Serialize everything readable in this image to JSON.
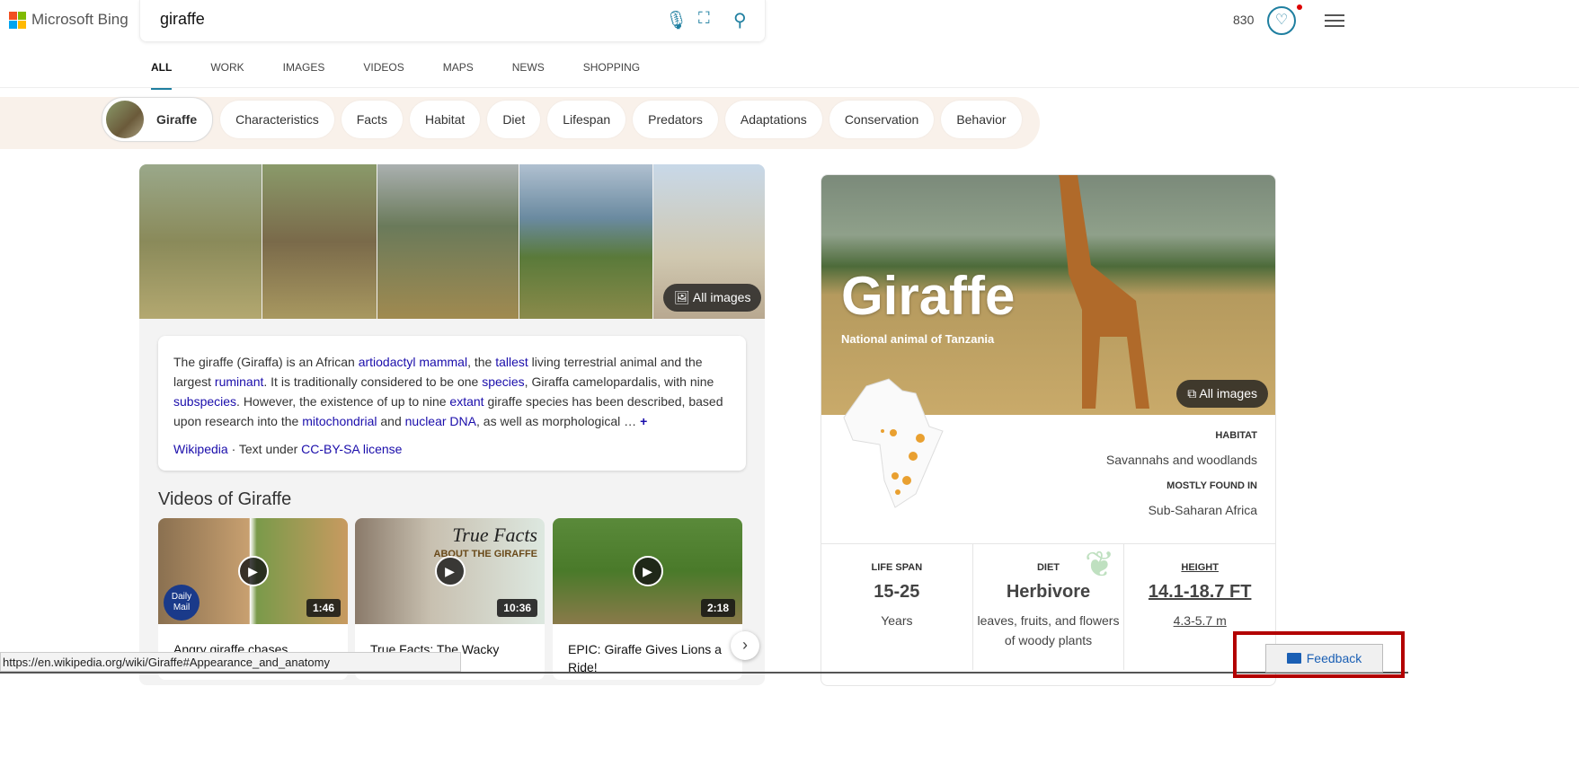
{
  "header": {
    "brand": "Microsoft Bing",
    "query": "giraffe",
    "points": "830"
  },
  "tabs": [
    "ALL",
    "WORK",
    "IMAGES",
    "VIDEOS",
    "MAPS",
    "NEWS",
    "SHOPPING"
  ],
  "pills": [
    "Giraffe",
    "Characteristics",
    "Facts",
    "Habitat",
    "Diet",
    "Lifespan",
    "Predators",
    "Adaptations",
    "Conservation",
    "Behavior"
  ],
  "images": {
    "all_images": "All images"
  },
  "description": {
    "t1": "The giraffe (Giraffa) is an African ",
    "l1": "artiodactyl mammal",
    "t2": ", the ",
    "l2": "tallest",
    "t3": " living terrestrial animal and the largest ",
    "l3": "ruminant",
    "t4": ". It is traditionally considered to be one ",
    "l4": "species",
    "t5": ", Giraffa camelopardalis, with nine ",
    "l5": "subspecies",
    "t6": ". However, the existence of up to nine ",
    "l6": "extant",
    "t7": " giraffe species has been described, based upon research into the ",
    "l7": "mitochondrial",
    "t8": " and ",
    "l8": "nuclear DNA",
    "t9": ", as well as morphological … ",
    "more": "+",
    "source": "Wikipedia",
    "license_prefix": " · Text under ",
    "license": "CC-BY-SA license"
  },
  "videos": {
    "title": "Videos of Giraffe",
    "items": [
      {
        "title": "Angry giraffe chases",
        "duration": "1:46",
        "badge": "Daily Mail"
      },
      {
        "title": "True Facts: The Wacky",
        "duration": "10:36",
        "overlay1": "True Facts",
        "overlay2": "ABOUT THE GIRAFFE"
      },
      {
        "title": "EPIC: Giraffe Gives Lions a Ride!",
        "duration": "2:18"
      }
    ]
  },
  "status_url": "https://en.wikipedia.org/wiki/Giraffe#Appearance_and_anatomy",
  "card": {
    "title": "Giraffe",
    "subtitle": "National animal of Tanzania",
    "all_images": "All images",
    "habitat_label": "HABITAT",
    "habitat": "Savannahs and woodlands",
    "found_label": "MOSTLY FOUND IN",
    "found": "Sub-Saharan Africa",
    "lifespan_label": "LIFE SPAN",
    "lifespan": "15-25",
    "lifespan_unit": "Years",
    "diet_label": "DIET",
    "diet": "Herbivore",
    "diet_detail": "leaves, fruits, and flowers of woody plants",
    "height_label": "HEIGHT",
    "height": "14.1-18.7 FT",
    "height_m": "4.3-5.7 m"
  },
  "feedback": "Feedback",
  "colors": {
    "accent": "#1f7fa0",
    "link": "#1a0dab",
    "highlight": "#b30000"
  }
}
